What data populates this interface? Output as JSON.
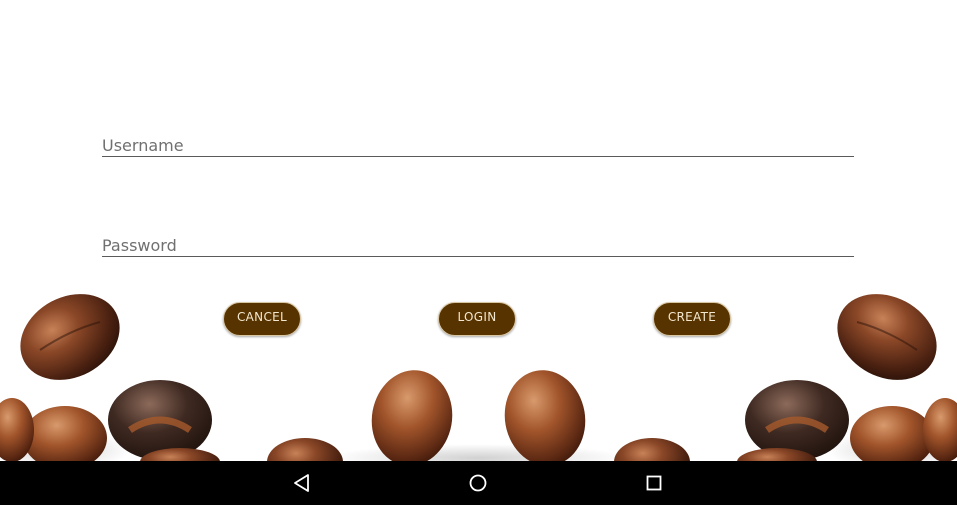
{
  "login_form": {
    "username_placeholder": "Username",
    "username_value": "",
    "password_placeholder": "Password",
    "password_value": ""
  },
  "buttons": {
    "cancel_label": "CANCEL",
    "login_label": "LOGIN",
    "create_label": "CREATE"
  },
  "system_nav": {
    "back_icon": "back-triangle-icon",
    "home_icon": "home-circle-icon",
    "recents_icon": "recents-square-icon"
  },
  "colors": {
    "button_fill": "#573300",
    "button_text": "#f3e7cf",
    "navbar": "#000000",
    "background": "#ffffff"
  }
}
